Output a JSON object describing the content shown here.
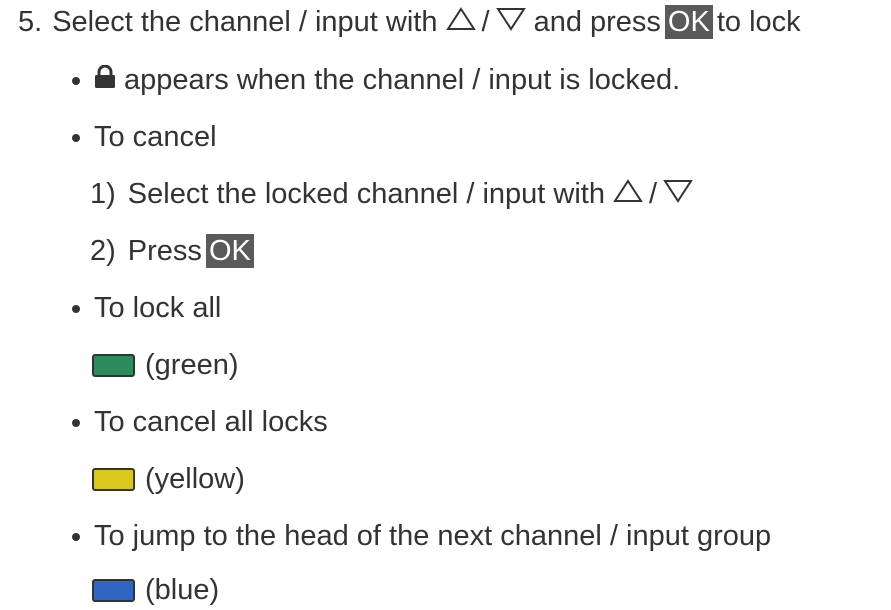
{
  "step5": {
    "number": "5.",
    "text_before": "Select the channel / input with",
    "slash": "/",
    "text_middle": "and press",
    "ok_label": "OK",
    "text_after": "to lock"
  },
  "bullet_locked": {
    "text": "appears when the channel / input is locked."
  },
  "bullet_cancel": {
    "text": "To cancel"
  },
  "cancel_step1": {
    "number": "1)",
    "text": "Select the locked channel / input with",
    "slash": "/"
  },
  "cancel_step2": {
    "number": "2)",
    "text": "Press",
    "ok_label": "OK"
  },
  "bullet_lock_all": {
    "text": "To lock all"
  },
  "green_key": {
    "color": "#2e8b5e",
    "label": "(green)"
  },
  "bullet_cancel_all": {
    "text": "To cancel all locks"
  },
  "yellow_key": {
    "color": "#d8c81c",
    "label": "(yellow)"
  },
  "bullet_jump": {
    "text": "To jump to the head of the next channel / input group"
  },
  "blue_key": {
    "color": "#2f66c4",
    "label": "(blue)"
  }
}
